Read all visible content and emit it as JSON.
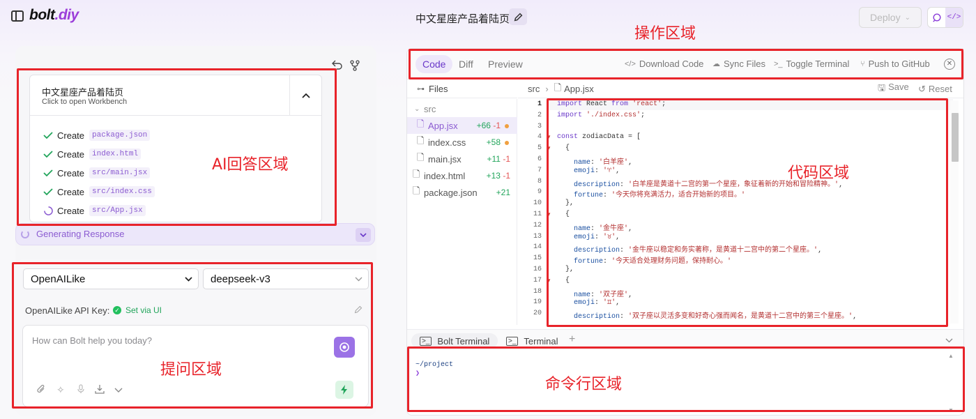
{
  "app": {
    "logo_main": "bolt",
    "logo_accent": ".diy",
    "project_title": "中文星座产品着陆页",
    "deploy_label": "Deploy"
  },
  "chat": {
    "artifact": {
      "title": "中文星座产品着陆页",
      "subtitle": "Click to open Workbench",
      "steps": [
        {
          "verb": "Create",
          "file": "package.json",
          "status": "done"
        },
        {
          "verb": "Create",
          "file": "index.html",
          "status": "done"
        },
        {
          "verb": "Create",
          "file": "src/main.jsx",
          "status": "done"
        },
        {
          "verb": "Create",
          "file": "src/index.css",
          "status": "done"
        },
        {
          "verb": "Create",
          "file": "src/App.jsx",
          "status": "loading"
        }
      ]
    },
    "generating_label": "Generating Response"
  },
  "input": {
    "provider": "OpenAILike",
    "model": "deepseek-v3",
    "api_key_label": "OpenAILike API Key:",
    "api_key_status": "Set via UI",
    "placeholder": "How can Bolt help you today?"
  },
  "workbench": {
    "tabs": [
      "Code",
      "Diff",
      "Preview"
    ],
    "active_tab": "Code",
    "actions": {
      "download": "Download Code",
      "sync": "Sync Files",
      "terminal": "Toggle Terminal",
      "github": "Push to GitHub"
    },
    "files_label": "Files",
    "files": [
      {
        "name": "src",
        "type": "folder",
        "diff_add": "",
        "diff_del": ""
      },
      {
        "name": "App.jsx",
        "type": "file",
        "diff_add": "+66",
        "diff_del": "-1",
        "modified": true,
        "selected": true
      },
      {
        "name": "index.css",
        "type": "file",
        "diff_add": "+58",
        "diff_del": "",
        "modified": true
      },
      {
        "name": "main.jsx",
        "type": "file",
        "diff_add": "+11",
        "diff_del": "-1"
      },
      {
        "name": "index.html",
        "type": "file",
        "diff_add": "+13",
        "diff_del": "-1"
      },
      {
        "name": "package.json",
        "type": "file",
        "diff_add": "+21",
        "diff_del": ""
      }
    ],
    "breadcrumb": {
      "folder": "src",
      "file": "App.jsx"
    },
    "save_label": "Save",
    "reset_label": "Reset",
    "code_lines": [
      "import React from 'react';",
      "import './index.css';",
      "",
      "const zodiacData = [",
      "  {",
      "    name: '白羊座',",
      "    emoji: '♈',",
      "    description: '白羊座是黄道十二宫的第一个星座，象征着新的开始和冒险精神。',",
      "    fortune: '今天你将充满活力，适合开始新的项目。'",
      "  },",
      "  {",
      "    name: '金牛座',",
      "    emoji: '♉',",
      "    description: '金牛座以稳定和务实著称，是黄道十二宫中的第二个星座。',",
      "    fortune: '今天适合处理财务问题，保持耐心。'",
      "  },",
      "  {",
      "    name: '双子座',",
      "    emoji: '♊',",
      "    description: '双子座以灵活多变和好奇心强而闻名，是黄道十二宫中的第三个星座。',"
    ],
    "terminal_tabs": [
      "Bolt Terminal",
      "Terminal"
    ],
    "terminal_lines": [
      "~/project",
      "❯"
    ]
  },
  "annotations": {
    "ai": "AI回答区域",
    "prompt": "提问区域",
    "ops": "操作区域",
    "code": "代码区域",
    "cli": "命令行区域"
  }
}
